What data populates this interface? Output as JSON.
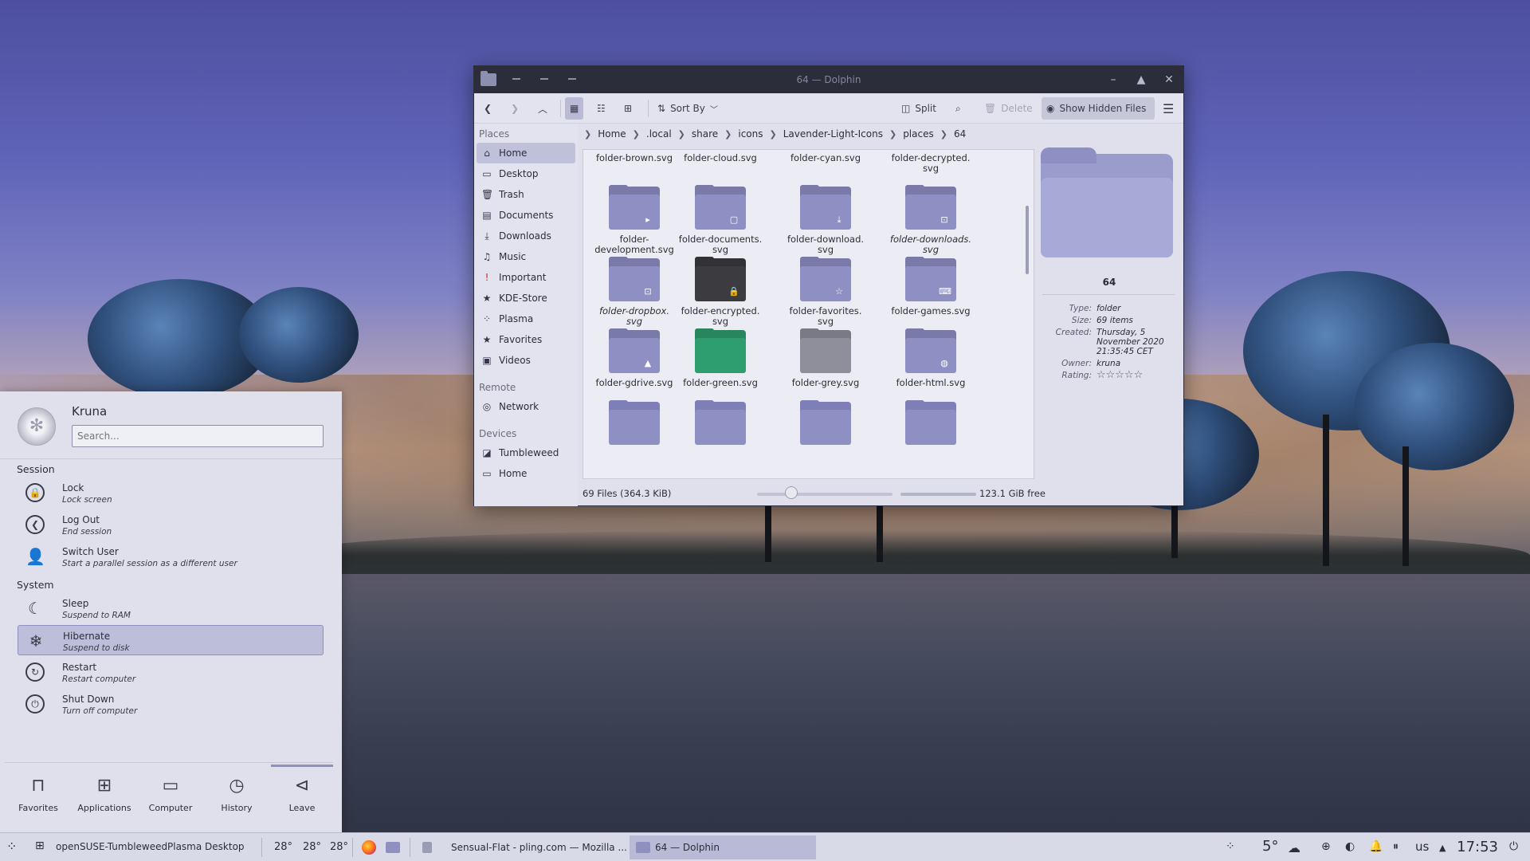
{
  "dolphin": {
    "title": "64 — Dolphin",
    "toolbar": {
      "sort_by": "Sort By",
      "split": "Split",
      "delete": "Delete",
      "show_hidden": "Show Hidden Files"
    },
    "places": {
      "header": "Places",
      "items": [
        {
          "label": "Home",
          "icon": "home-icon"
        },
        {
          "label": "Desktop",
          "icon": "desktop-icon"
        },
        {
          "label": "Trash",
          "icon": "trash-icon"
        },
        {
          "label": "Documents",
          "icon": "documents-icon"
        },
        {
          "label": "Downloads",
          "icon": "downloads-icon"
        },
        {
          "label": "Music",
          "icon": "music-icon"
        },
        {
          "label": "Important",
          "icon": "important-icon"
        },
        {
          "label": "KDE-Store",
          "icon": "star-icon"
        },
        {
          "label": "Plasma",
          "icon": "plasma-icon"
        },
        {
          "label": "Favorites",
          "icon": "star-icon"
        },
        {
          "label": "Videos",
          "icon": "videos-icon"
        }
      ],
      "remote_header": "Remote",
      "remote_items": [
        {
          "label": "Network",
          "icon": "network-icon"
        }
      ],
      "devices_header": "Devices",
      "device_items": [
        {
          "label": "Tumbleweed",
          "icon": "drive-icon"
        },
        {
          "label": "Home",
          "icon": "drive-icon"
        }
      ]
    },
    "breadcrumb": [
      "Home",
      ".local",
      "share",
      "icons",
      "Lavender-Light-Icons",
      "places",
      "64"
    ],
    "files_top_row": [
      "folder-brown.svg",
      "folder-cloud.svg",
      "folder-cyan.svg",
      "folder-decrypted.\nsvg"
    ],
    "files": [
      {
        "name": "folder-\ndevelopment.svg",
        "color": "#8e90c4",
        "emblem": "▸",
        "italic": false
      },
      {
        "name": "folder-documents.\nsvg",
        "color": "#8e90c4",
        "emblem": "▢",
        "italic": false
      },
      {
        "name": "folder-download.\nsvg",
        "color": "#8e90c4",
        "emblem": "⤓",
        "italic": false
      },
      {
        "name": "folder-downloads.\nsvg",
        "color": "#8e90c4",
        "emblem": "⊡",
        "italic": true
      },
      {
        "name": "folder-dropbox.\nsvg",
        "color": "#8e90c4",
        "emblem": "⊡",
        "italic": true
      },
      {
        "name": "folder-encrypted.\nsvg",
        "color": "#3b3b40",
        "emblem": "🔒",
        "italic": false
      },
      {
        "name": "folder-favorites.\nsvg",
        "color": "#8e90c4",
        "emblem": "☆",
        "italic": false
      },
      {
        "name": "folder-games.svg",
        "color": "#8e90c4",
        "emblem": "⌨",
        "italic": false
      },
      {
        "name": "folder-gdrive.svg",
        "color": "#8e90c4",
        "emblem": "▲",
        "italic": false
      },
      {
        "name": "folder-green.svg",
        "color": "#2f9e6e",
        "emblem": "",
        "italic": false
      },
      {
        "name": "folder-grey.svg",
        "color": "#8e8f9a",
        "emblem": "",
        "italic": false
      },
      {
        "name": "folder-html.svg",
        "color": "#8e90c4",
        "emblem": "◍",
        "italic": false
      }
    ],
    "info": {
      "name": "64",
      "type_label": "Type:",
      "type": "folder",
      "size_label": "Size:",
      "size": "69 items",
      "created_label": "Created:",
      "created": "Thursday, 5 November 2020 21:35:45 CET",
      "owner_label": "Owner:",
      "owner": "kruna",
      "rating_label": "Rating:",
      "rating": "☆☆☆☆☆"
    },
    "status": {
      "files": "69 Files (364.3 KiB)",
      "free": "123.1 GiB free",
      "zoom": 0.25,
      "disk_used": 0.85
    }
  },
  "launcher": {
    "user": "Kruna",
    "search_placeholder": "Search...",
    "session_header": "Session",
    "session_items": [
      {
        "label": "Lock",
        "sub": "Lock screen",
        "icon": "lock-icon"
      },
      {
        "label": "Log Out",
        "sub": "End session",
        "icon": "logout-icon"
      },
      {
        "label": "Switch User",
        "sub": "Start a parallel session as a different user",
        "icon": "switch-user-icon"
      }
    ],
    "system_header": "System",
    "system_items": [
      {
        "label": "Sleep",
        "sub": "Suspend to RAM",
        "icon": "sleep-icon"
      },
      {
        "label": "Hibernate",
        "sub": "Suspend to disk",
        "icon": "hibernate-icon"
      },
      {
        "label": "Restart",
        "sub": "Restart computer",
        "icon": "restart-icon"
      },
      {
        "label": "Shut Down",
        "sub": "Turn off computer",
        "icon": "shutdown-icon"
      }
    ],
    "tabs": [
      "Favorites",
      "Applications",
      "Computer",
      "History",
      "Leave"
    ]
  },
  "taskbar": {
    "distro": "openSUSE-Tumbleweed",
    "desktop": "Plasma Desktop",
    "temps": [
      "28°",
      "28°",
      "28°"
    ],
    "task_firefox": "Sensual-Flat - pling.com — Mozilla ...",
    "task_dolphin": "64 — Dolphin",
    "weather": "5°",
    "keyboard": "us",
    "clock": "17:53"
  }
}
